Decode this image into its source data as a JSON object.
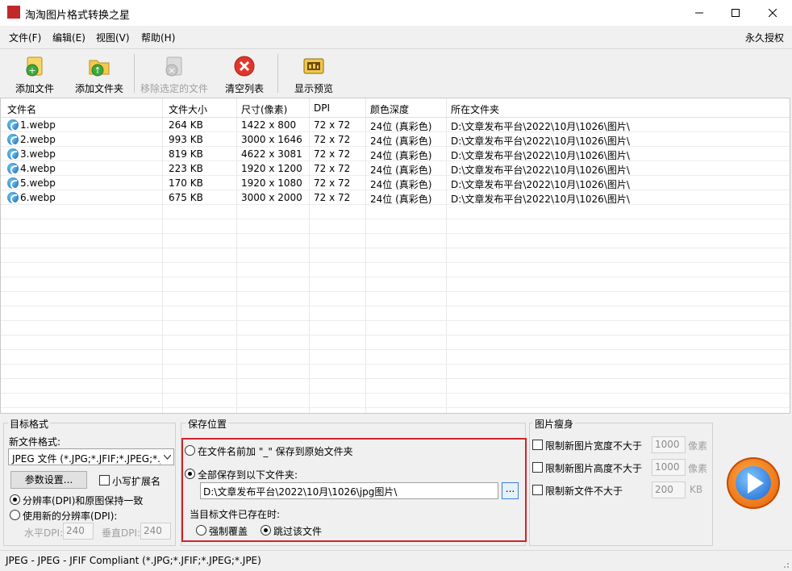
{
  "window": {
    "title": "淘淘图片格式转换之星",
    "app_icon_text": "图片转换"
  },
  "menu": {
    "items": [
      "文件(F)",
      "编辑(E)",
      "视图(V)",
      "帮助(H)"
    ],
    "license": "永久授权"
  },
  "toolbar": {
    "add_file": "添加文件",
    "add_folder": "添加文件夹",
    "remove_selected": "移除选定的文件",
    "clear_list": "清空列表",
    "show_preview": "显示预览"
  },
  "filelist": {
    "columns": [
      "文件名",
      "文件大小",
      "尺寸(像素)",
      "DPI",
      "颜色深度",
      "所在文件夹"
    ],
    "rows": [
      {
        "name": "1.webp",
        "size": "264 KB",
        "dims": "1422 x 800",
        "dpi": "72 x 72",
        "depth": "24位 (真彩色)",
        "folder": "D:\\文章发布平台\\2022\\10月\\1026\\图片\\"
      },
      {
        "name": "2.webp",
        "size": "993 KB",
        "dims": "3000 x 1646",
        "dpi": "72 x 72",
        "depth": "24位 (真彩色)",
        "folder": "D:\\文章发布平台\\2022\\10月\\1026\\图片\\"
      },
      {
        "name": "3.webp",
        "size": "819 KB",
        "dims": "4622 x 3081",
        "dpi": "72 x 72",
        "depth": "24位 (真彩色)",
        "folder": "D:\\文章发布平台\\2022\\10月\\1026\\图片\\"
      },
      {
        "name": "4.webp",
        "size": "223 KB",
        "dims": "1920 x 1200",
        "dpi": "72 x 72",
        "depth": "24位 (真彩色)",
        "folder": "D:\\文章发布平台\\2022\\10月\\1026\\图片\\"
      },
      {
        "name": "5.webp",
        "size": "170 KB",
        "dims": "1920 x 1080",
        "dpi": "72 x 72",
        "depth": "24位 (真彩色)",
        "folder": "D:\\文章发布平台\\2022\\10月\\1026\\图片\\"
      },
      {
        "name": "6.webp",
        "size": "675 KB",
        "dims": "3000 x 2000",
        "dpi": "72 x 72",
        "depth": "24位 (真彩色)",
        "folder": "D:\\文章发布平台\\2022\\10月\\1026\\图片\\"
      }
    ]
  },
  "target_format": {
    "title": "目标格式",
    "new_format_label": "新文件格式:",
    "format_value": "JPEG 文件 (*.JPG;*.JFIF;*.JPEG;*.JPE)",
    "params_button": "参数设置...",
    "lowercase_ext": "小写扩展名",
    "dpi_keep": "分辨率(DPI)和原图保持一致",
    "dpi_new": "使用新的分辨率(DPI):",
    "h_dpi_label": "水平DPI:",
    "h_dpi_value": "240",
    "v_dpi_label": "垂直DPI:",
    "v_dpi_value": "240"
  },
  "save_location": {
    "title": "保存位置",
    "option_prefix": "在文件名前加 \"_\" 保存到原始文件夹",
    "option_all": "全部保存到以下文件夹:",
    "folder_path": "D:\\文章发布平台\\2022\\10月\\1026\\jpg图片\\",
    "browse": "...",
    "exists_label": "当目标文件已存在时:",
    "overwrite": "强制覆盖",
    "skip": "跳过该文件"
  },
  "slim": {
    "title": "图片瘦身",
    "limit_width": "限制新图片宽度不大于",
    "width_value": "1000",
    "width_unit": "像素",
    "limit_height": "限制新图片高度不大于",
    "height_value": "1000",
    "height_unit": "像素",
    "limit_size": "限制新文件不大于",
    "size_value": "200",
    "size_unit": "KB"
  },
  "status": {
    "text": "JPEG - JPEG - JFIF Compliant (*.JPG;*.JFIF;*.JPEG;*.JPE)"
  }
}
